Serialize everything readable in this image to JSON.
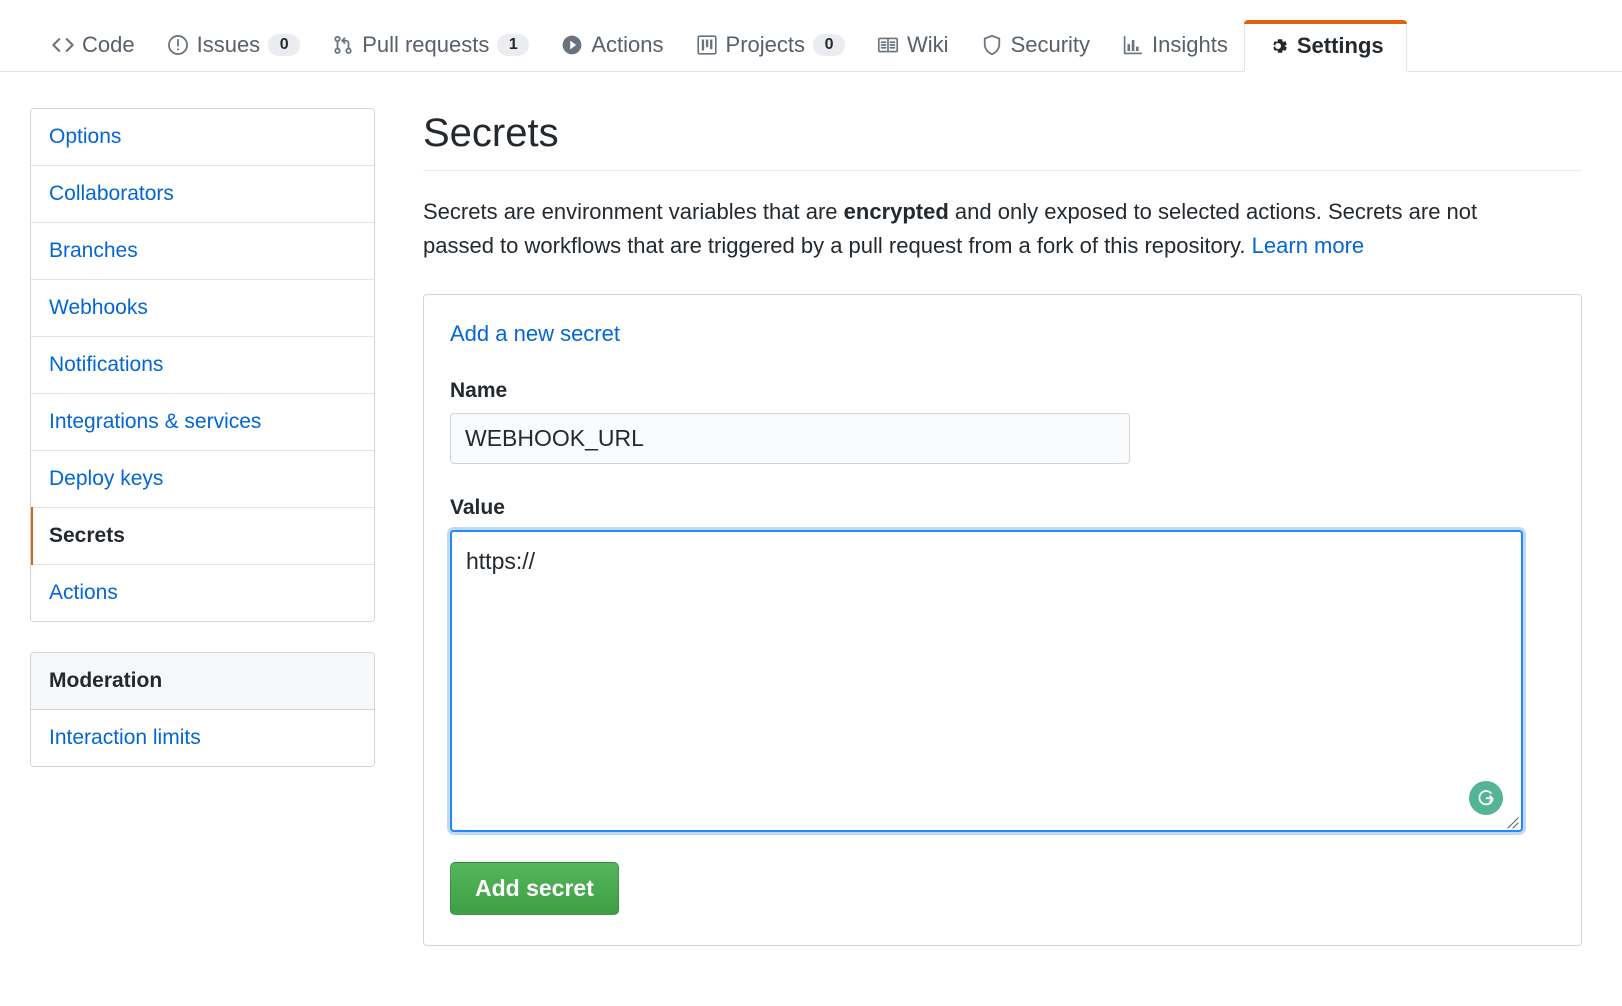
{
  "repo_nav": {
    "items": [
      {
        "label": "Code",
        "icon": "code-icon",
        "count": null,
        "selected": false
      },
      {
        "label": "Issues",
        "icon": "issue-icon",
        "count": "0",
        "selected": false
      },
      {
        "label": "Pull requests",
        "icon": "pr-icon",
        "count": "1",
        "selected": false
      },
      {
        "label": "Actions",
        "icon": "play-icon",
        "count": null,
        "selected": false
      },
      {
        "label": "Projects",
        "icon": "project-icon",
        "count": "0",
        "selected": false
      },
      {
        "label": "Wiki",
        "icon": "book-icon",
        "count": null,
        "selected": false
      },
      {
        "label": "Security",
        "icon": "shield-icon",
        "count": null,
        "selected": false
      },
      {
        "label": "Insights",
        "icon": "graph-icon",
        "count": null,
        "selected": false
      },
      {
        "label": "Settings",
        "icon": "gear-icon",
        "count": null,
        "selected": true
      }
    ]
  },
  "sidebar": {
    "menus": [
      {
        "heading": null,
        "items": [
          {
            "label": "Options",
            "selected": false
          },
          {
            "label": "Collaborators",
            "selected": false
          },
          {
            "label": "Branches",
            "selected": false
          },
          {
            "label": "Webhooks",
            "selected": false
          },
          {
            "label": "Notifications",
            "selected": false
          },
          {
            "label": "Integrations & services",
            "selected": false
          },
          {
            "label": "Deploy keys",
            "selected": false
          },
          {
            "label": "Secrets",
            "selected": true
          },
          {
            "label": "Actions",
            "selected": false
          }
        ]
      },
      {
        "heading": "Moderation",
        "items": [
          {
            "label": "Interaction limits",
            "selected": false
          }
        ]
      }
    ]
  },
  "main": {
    "title": "Secrets",
    "intro": {
      "part1": "Secrets are environment variables that are ",
      "bold": "encrypted",
      "part2": " and only exposed to selected actions. Secrets are not passed to workflows that are triggered by a pull request from a fork of this repository. ",
      "link": "Learn more"
    },
    "form": {
      "title": "Add a new secret",
      "name_label": "Name",
      "name_value": "WEBHOOK_URL",
      "name_placeholder": "YOUR_SECRET_NAME",
      "value_label": "Value",
      "value_value": "https://",
      "value_placeholder": "",
      "submit_label": "Add secret",
      "grammarly_glyph": "G"
    }
  },
  "colors": {
    "accent_orange": "#e36209",
    "link_blue": "#0366d6",
    "focus_blue": "#2188ff",
    "button_green": "#4caf50",
    "grammarly_green": "#56b496"
  }
}
